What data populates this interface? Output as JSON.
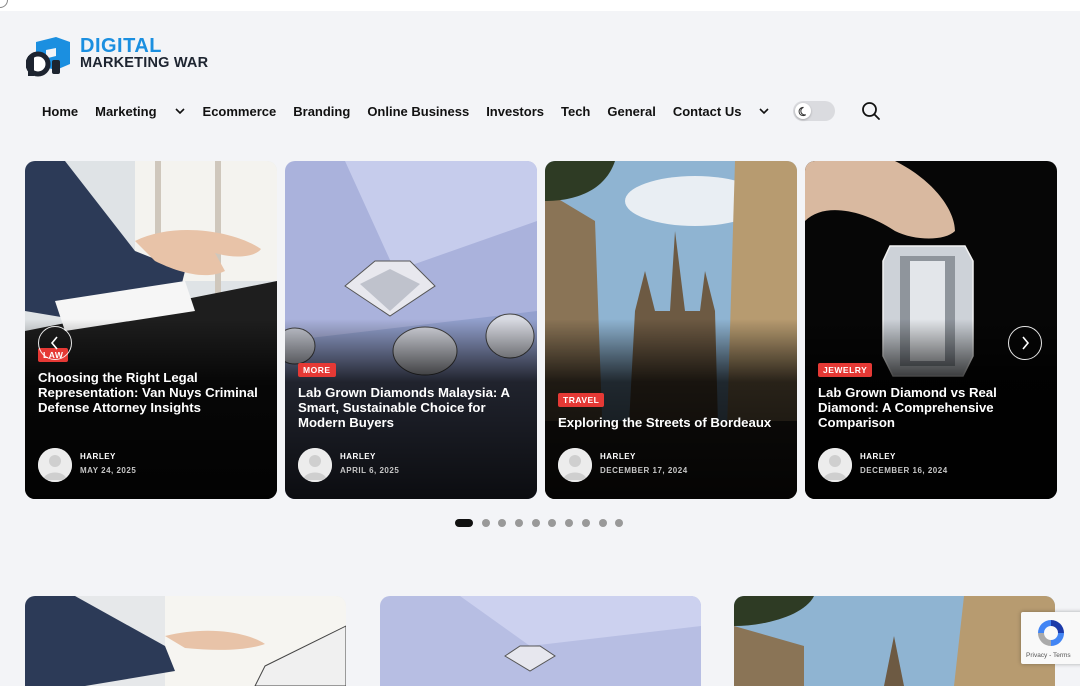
{
  "brand": {
    "line1": "DIGITAL",
    "line2": "MARKETING WAR",
    "colors": {
      "accent": "#1b8fe0",
      "dark": "#1d2430",
      "badge": "#e53935"
    }
  },
  "nav": {
    "home": "Home",
    "marketing": "Marketing",
    "ecommerce": "Ecommerce",
    "branding": "Branding",
    "online_business": "Online Business",
    "investors": "Investors",
    "tech": "Tech",
    "general": "General",
    "contact": "Contact Us",
    "icons": [
      "chevron-down-icon",
      "moon-icon",
      "search-icon"
    ]
  },
  "slides": [
    {
      "category": "LAW",
      "title": "Choosing the Right Legal Representation: Van Nuys Criminal Defense Attorney Insights",
      "author": "HARLEY",
      "date": "MAY 24, 2025"
    },
    {
      "category": "MORE",
      "title": "Lab Grown Diamonds Malaysia: A Smart, Sustainable Choice for Modern Buyers",
      "author": "HARLEY",
      "date": "APRIL 6, 2025"
    },
    {
      "category": "TRAVEL",
      "title": "Exploring the Streets of Bordeaux",
      "author": "HARLEY",
      "date": "DECEMBER 17, 2024"
    },
    {
      "category": "JEWELRY",
      "title": "Lab Grown Diamond vs Real Diamond: A Comprehensive Comparison",
      "author": "HARLEY",
      "date": "DECEMBER 16, 2024"
    }
  ],
  "pagination": {
    "total": 10,
    "active": 1
  },
  "recaptcha": {
    "links": "Privacy - Terms"
  }
}
